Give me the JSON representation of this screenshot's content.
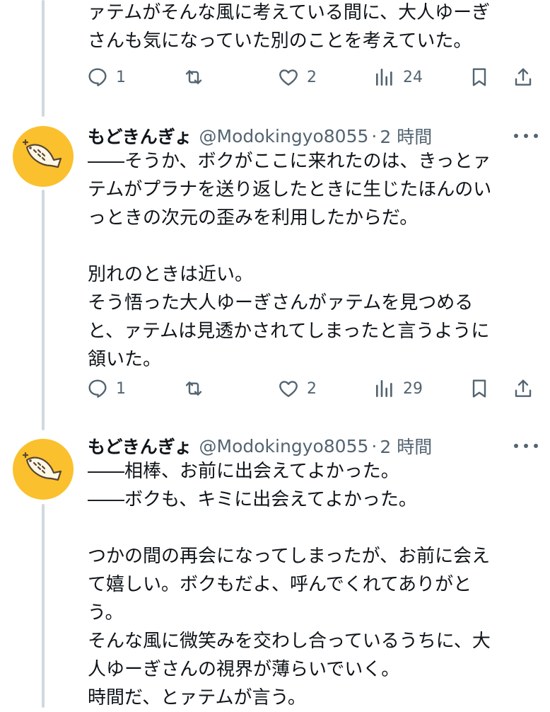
{
  "tweets": [
    {
      "text": "ァテムがそんな風に考えている間に、大人ゆーぎ\nさんも気になっていた別のことを考えていた。",
      "replies": "1",
      "retweets": "",
      "likes": "2",
      "views": "24"
    },
    {
      "name": "もどきんぎょ",
      "handle": "@Modokingyo8055",
      "separator": "·",
      "time": "2 時間",
      "text": "――そうか、ボクがここに来れたのは、きっとァ\nテムがプラナを送り返したときに生じたほんのい\nっときの次元の歪みを利用したからだ。\n\n別れのときは近い。\nそう悟った大人ゆーぎさんがァテムを見つめる\nと、ァテムは見透かされてしまったと言うように\n頷いた。",
      "replies": "1",
      "retweets": "",
      "likes": "2",
      "views": "29"
    },
    {
      "name": "もどきんぎょ",
      "handle": "@Modokingyo8055",
      "separator": "·",
      "time": "2 時間",
      "text": "――相棒、お前に出会えてよかった。\n――ボクも、キミに出会えてよかった。\n\nつかの間の再会になってしまったが、お前に会え\nて嬉しい。ボクもだよ、呼んでくれてありがと\nう。\nそんな風に微笑みを交わし合っているうちに、大\n人ゆーぎさんの視界が薄らいでいく。\n時間だ、とァテムが言う。"
    }
  ],
  "icons": {
    "reply": "reply-icon",
    "retweet": "retweet-icon",
    "like": "heart-icon",
    "views": "views-icon",
    "bookmark": "bookmark-icon",
    "share": "share-icon",
    "more": "more-icon",
    "avatar": "fish-avatar-icon"
  },
  "colors": {
    "avatar_bg": "#fbc02d",
    "secondary_text": "#536471",
    "thread_line": "#cfd9de"
  }
}
